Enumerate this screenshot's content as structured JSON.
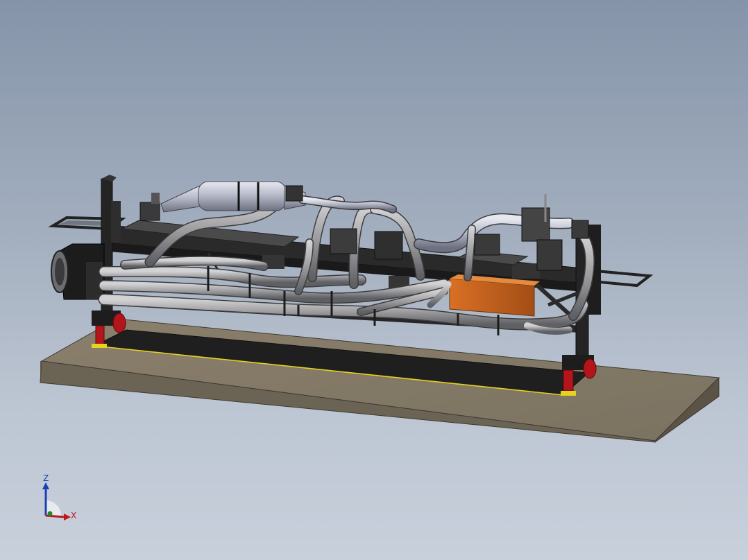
{
  "viewport": {
    "background_top": "#8594a9",
    "background_bottom": "#c8d0dc"
  },
  "model": {
    "slab_color": "#8a7f6c",
    "frame_color": "#2b2b2b",
    "pipe_color": "#a9a9ab",
    "catalyst_color": "#c7cbd6",
    "box_color": "#c0601d",
    "caster_color": "#b3151a",
    "accent_yellow": "#e4d321"
  },
  "triad": {
    "z_label": "Z",
    "x_label": "X",
    "z_color": "#1a3fb5",
    "x_color": "#c0161b",
    "y_color": "#1c8a2b"
  }
}
